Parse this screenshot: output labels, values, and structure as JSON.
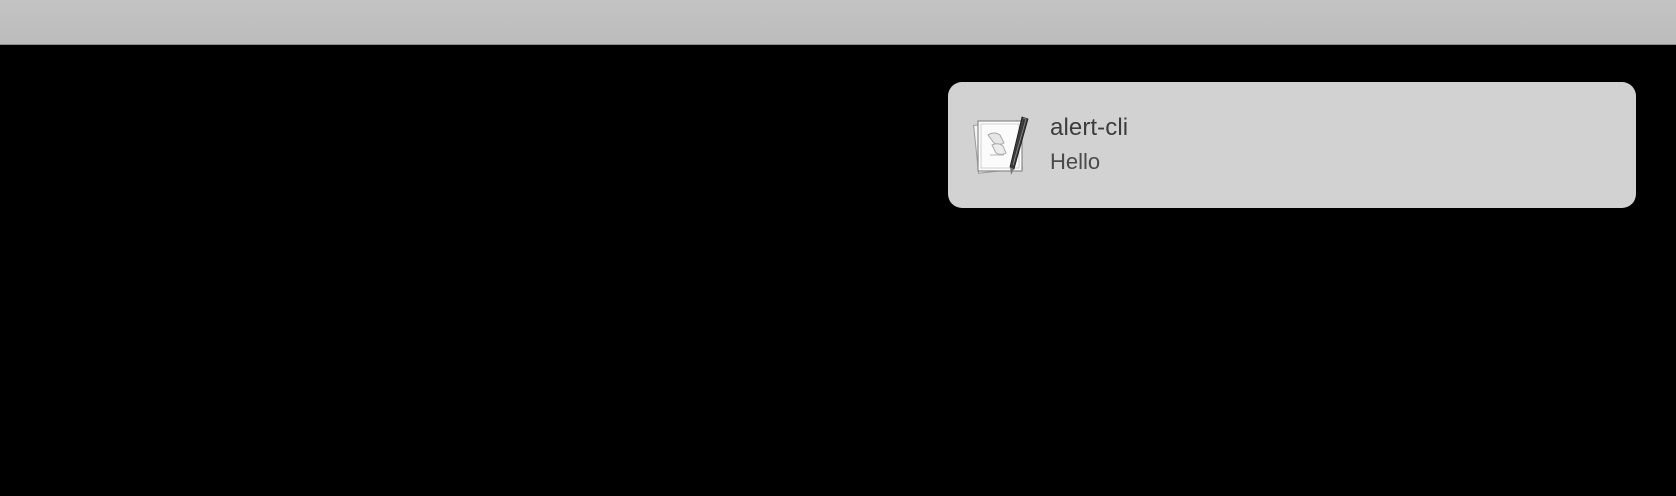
{
  "notification": {
    "app_icon": "script-editor-icon",
    "title": "alert-cli",
    "message": "Hello"
  },
  "colors": {
    "desktop": "#000000",
    "menu_bar": "#c0c0c0",
    "notification_bg": "#d2d2d2"
  }
}
